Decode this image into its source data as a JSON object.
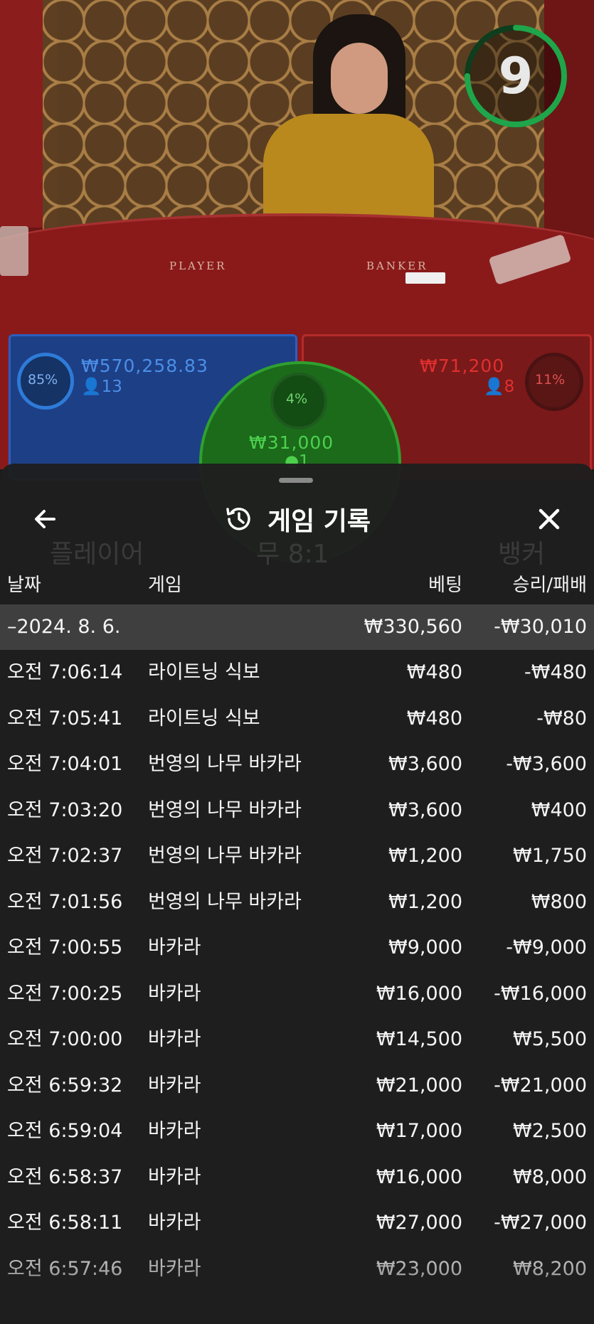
{
  "stream": {
    "timer_value": "9",
    "timer_fraction": 0.75,
    "table_labels": {
      "player": "PLAYER",
      "banker": "BANKER"
    }
  },
  "bets": {
    "player": {
      "percent": "85%",
      "amount": "₩570,258.83",
      "players": "13"
    },
    "tie": {
      "percent": "4%",
      "amount": "₩31,000",
      "players": "1"
    },
    "banker": {
      "percent": "11%",
      "amount": "₩71,200",
      "players": "8"
    }
  },
  "background_labels": {
    "player": "플레이어",
    "tie": "무 8:1",
    "banker": "뱅커"
  },
  "history": {
    "title": "게임 기록",
    "icons": {
      "back": "arrow-left-icon",
      "title": "history-icon",
      "close": "close-icon"
    },
    "columns": {
      "date": "날짜",
      "game": "게임",
      "bet": "베팅",
      "result": "승리/패배"
    },
    "date_group": {
      "date": "–2024. 8. 6.",
      "total_bet": "₩330,560",
      "total_result": "-₩30,010"
    },
    "rows": [
      {
        "time": "오전 7:06:14",
        "game": "라이트닝 식보",
        "bet": "₩480",
        "result": "-₩480"
      },
      {
        "time": "오전 7:05:41",
        "game": "라이트닝 식보",
        "bet": "₩480",
        "result": "-₩80"
      },
      {
        "time": "오전 7:04:01",
        "game": "번영의 나무 바카라",
        "bet": "₩3,600",
        "result": "-₩3,600"
      },
      {
        "time": "오전 7:03:20",
        "game": "번영의 나무 바카라",
        "bet": "₩3,600",
        "result": "₩400"
      },
      {
        "time": "오전 7:02:37",
        "game": "번영의 나무 바카라",
        "bet": "₩1,200",
        "result": "₩1,750"
      },
      {
        "time": "오전 7:01:56",
        "game": "번영의 나무 바카라",
        "bet": "₩1,200",
        "result": "₩800"
      },
      {
        "time": "오전 7:00:55",
        "game": "바카라",
        "bet": "₩9,000",
        "result": "-₩9,000"
      },
      {
        "time": "오전 7:00:25",
        "game": "바카라",
        "bet": "₩16,000",
        "result": "-₩16,000"
      },
      {
        "time": "오전 7:00:00",
        "game": "바카라",
        "bet": "₩14,500",
        "result": "₩5,500"
      },
      {
        "time": "오전 6:59:32",
        "game": "바카라",
        "bet": "₩21,000",
        "result": "-₩21,000"
      },
      {
        "time": "오전 6:59:04",
        "game": "바카라",
        "bet": "₩17,000",
        "result": "₩2,500"
      },
      {
        "time": "오전 6:58:37",
        "game": "바카라",
        "bet": "₩16,000",
        "result": "₩8,000"
      },
      {
        "time": "오전 6:58:11",
        "game": "바카라",
        "bet": "₩27,000",
        "result": "-₩27,000"
      },
      {
        "time": "오전 6:57:46",
        "game": "바카라",
        "bet": "₩23,000",
        "result": "₩8,200"
      }
    ]
  },
  "colors": {
    "player": "#2e7bd8",
    "tie": "#2fa02f",
    "banker": "#d32a2a",
    "timer": "#1fa64a",
    "panel": "#1e1e1e",
    "date_row": "#3f3f3f"
  }
}
